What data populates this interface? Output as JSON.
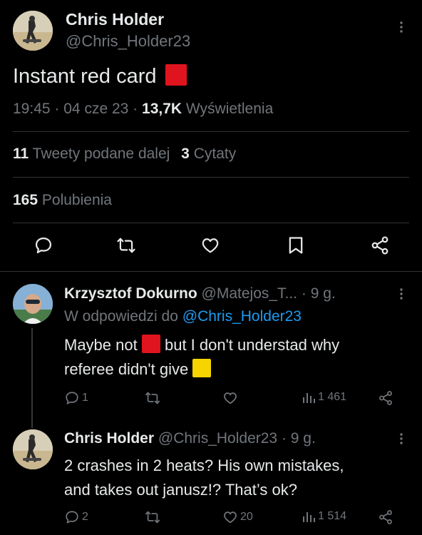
{
  "main_tweet": {
    "author_name": "Chris Holder",
    "handle": "@Chris_Holder23",
    "text": "Instant red card",
    "time": "19:45",
    "date": "04 cze 23",
    "views_count": "13,7K",
    "views_label": "Wyświetlenia",
    "retweets_count": "11",
    "retweets_label": "Tweety podane dalej",
    "quotes_count": "3",
    "quotes_label": "Cytaty",
    "likes_count": "165",
    "likes_label": "Polubienia",
    "dot": "·"
  },
  "replies": [
    {
      "author_name": "Krzysztof Dokurno",
      "handle": "@Matejos_T...",
      "time": "9 g.",
      "reply_to_prefix": "W odpowiedzi do",
      "reply_to_handle": "@Chris_Holder23",
      "text_part1": "Maybe not",
      "text_part2": "but I don't understad why",
      "text_line2": "referee didn't give",
      "reply_count": "1",
      "retweet_count": "",
      "like_count": "",
      "views_count": "1 461"
    },
    {
      "author_name": "Chris Holder",
      "handle": "@Chris_Holder23",
      "time": "9 g.",
      "text_line1": "2 crashes in 2 heats? His own mistakes,",
      "text_line2": "and takes out janusz!? That’s ok?",
      "reply_count": "2",
      "retweet_count": "",
      "like_count": "20",
      "views_count": "1 514"
    }
  ],
  "icons": {
    "more": "more-vertical-icon",
    "reply": "reply-icon",
    "retweet": "retweet-icon",
    "like": "heart-icon",
    "bookmark": "bookmark-icon",
    "share": "share-icon",
    "views": "views-icon"
  },
  "colors": {
    "background": "#000000",
    "text": "#e7e9ea",
    "muted": "#71767b",
    "link": "#1d9bf0",
    "red_card": "#e0141e",
    "yellow_card": "#f5d400"
  }
}
